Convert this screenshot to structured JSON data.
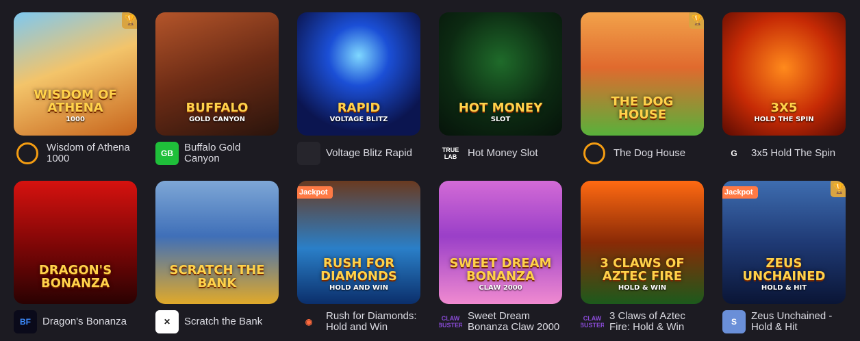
{
  "games": [
    {
      "name": "Wisdom of Athena 1000",
      "art_title": "Wisdom of Athena",
      "art_sub": "1000",
      "bg": "linear-gradient(160deg,#7ec8f0 0%,#f3c46a 45%,#c7641c 100%)",
      "trophy": true,
      "jackpot": false,
      "provider_icon": "pragmatic-icon",
      "provider_text": "",
      "provider_bg": "transparent",
      "provider_color": "#f39c12"
    },
    {
      "name": "Buffalo Gold Canyon",
      "art_title": "Buffalo",
      "art_sub": "Gold Canyon",
      "bg": "linear-gradient(160deg,#b4552a 0%,#6b2b15 50%,#2a140c 100%)",
      "trophy": false,
      "jackpot": false,
      "provider_icon": "gb-icon",
      "provider_text": "GB",
      "provider_bg": "#1fbf3a",
      "provider_color": "#ffffff"
    },
    {
      "name": "Voltage Blitz Rapid",
      "art_title": "Rapid",
      "art_sub": "Voltage Blitz",
      "bg": "radial-gradient(circle at 50% 35%,#7fd8ff 0%,#1b4fd6 30%,#0b1550 75%)",
      "trophy": false,
      "jackpot": false,
      "provider_icon": "provider-placeholder-icon",
      "provider_text": "",
      "provider_bg": "#26252c",
      "provider_color": "#ffffff"
    },
    {
      "name": "Hot Money Slot",
      "art_title": "Hot Money",
      "art_sub": "Slot",
      "bg": "radial-gradient(circle at 50% 40%,#1f6b2a 0%,#0c2a12 55%,#06130a 100%)",
      "trophy": false,
      "jackpot": false,
      "provider_icon": "truelab-icon",
      "provider_text": "TRUE LAB",
      "provider_bg": "transparent",
      "provider_color": "#ffffff"
    },
    {
      "name": "The Dog House",
      "art_title": "The Dog House",
      "art_sub": "",
      "bg": "linear-gradient(180deg,#f2a24a 0%,#e06a2e 45%,#58b13b 100%)",
      "trophy": true,
      "jackpot": false,
      "provider_icon": "pragmatic-icon",
      "provider_text": "",
      "provider_bg": "transparent",
      "provider_color": "#f39c12"
    },
    {
      "name": "3x5 Hold The Spin",
      "art_title": "3X5",
      "art_sub": "Hold The Spin",
      "bg": "radial-gradient(circle at 50% 45%,#ff8a1c 0%,#c62a05 55%,#5a0b02 100%)",
      "trophy": false,
      "jackpot": false,
      "provider_icon": "gamzix-icon",
      "provider_text": "G",
      "provider_bg": "transparent",
      "provider_color": "#ffffff"
    },
    {
      "name": "Dragon's Bonanza",
      "art_title": "Dragon's Bonanza",
      "art_sub": "",
      "bg": "linear-gradient(180deg,#d6120f 0%,#7a0606 55%,#2a0202 100%)",
      "trophy": false,
      "jackpot": false,
      "provider_icon": "bf-games-icon",
      "provider_text": "BF",
      "provider_bg": "#0a0a1a",
      "provider_color": "#3d8cff"
    },
    {
      "name": "Scratch the Bank",
      "art_title": "Scratch the Bank",
      "art_sub": "",
      "bg": "linear-gradient(180deg,#7ea7d6 0%,#3f6fb8 45%,#e0a92a 100%)",
      "trophy": false,
      "jackpot": false,
      "provider_icon": "scratch-provider-icon",
      "provider_text": "✕",
      "provider_bg": "#ffffff",
      "provider_color": "#111111"
    },
    {
      "name": "Rush for Diamonds: Hold and Win",
      "art_title": "Rush for Diamonds",
      "art_sub": "Hold and Win",
      "bg": "linear-gradient(180deg,#6a3a20 0%,#2a7fc8 55%,#0b2f6b 100%)",
      "trophy": false,
      "jackpot": true,
      "provider_icon": "target-provider-icon",
      "provider_text": "◉",
      "provider_bg": "transparent",
      "provider_color": "#ff6a3d"
    },
    {
      "name": "Sweet Dream Bonanza Claw 2000",
      "art_title": "Sweet Dream Bonanza",
      "art_sub": "Claw 2000",
      "bg": "linear-gradient(180deg,#d36bd6 0%,#9a3fc8 45%,#f08ad0 100%)",
      "trophy": false,
      "jackpot": false,
      "provider_icon": "claw-buster-icon",
      "provider_text": "CLAW BUSTER",
      "provider_bg": "transparent",
      "provider_color": "#8a4bd8"
    },
    {
      "name": "3 Claws of Aztec Fire: Hold & Win",
      "art_title": "3 Claws of Aztec Fire",
      "art_sub": "Hold & Win",
      "bg": "linear-gradient(180deg,#ff6a12 0%,#8a2a06 50%,#1c5a1c 100%)",
      "trophy": false,
      "jackpot": false,
      "provider_icon": "claw-buster-icon",
      "provider_text": "CLAW BUSTER",
      "provider_bg": "transparent",
      "provider_color": "#8a4bd8"
    },
    {
      "name": "Zeus Unchained - Hold & Hit",
      "art_title": "Zeus Unchained",
      "art_sub": "Hold & Hit",
      "bg": "linear-gradient(180deg,#3e6db0 0%,#1f3a75 50%,#0a1535 100%)",
      "trophy": true,
      "jackpot": true,
      "provider_icon": "spinomenal-icon",
      "provider_text": "S",
      "provider_bg": "#6a8fd8",
      "provider_color": "#ffffff"
    }
  ],
  "labels": {
    "jackpot": "Jackpot",
    "trophy_glyph": "🏆"
  }
}
